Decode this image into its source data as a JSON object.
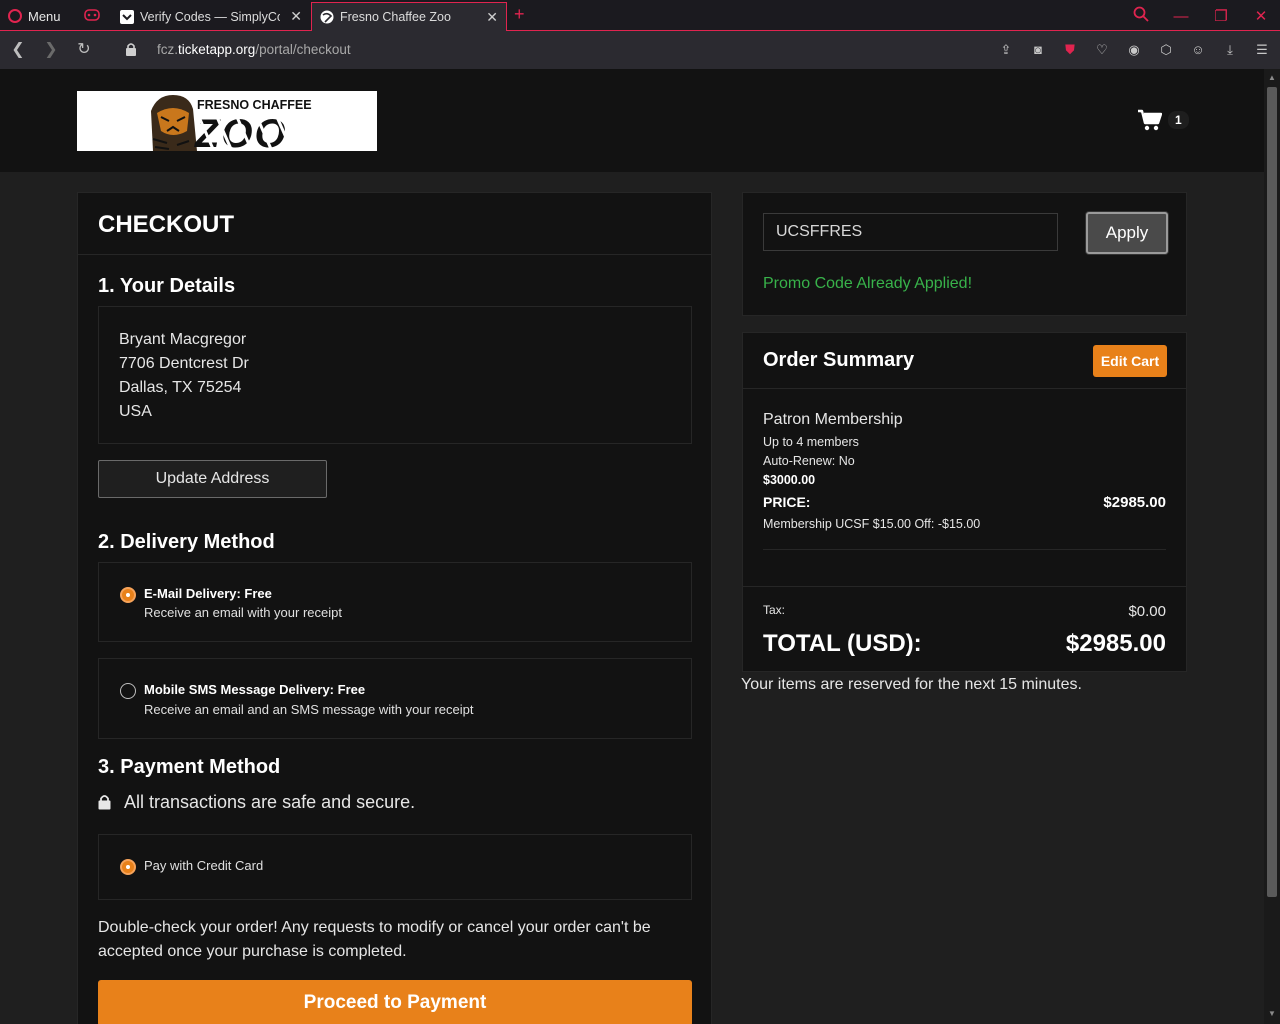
{
  "browser": {
    "menu_label": "Menu",
    "tabs": [
      {
        "label": "Verify Codes — SimplyCod"
      },
      {
        "label": "Fresno Chaffee Zoo"
      }
    ],
    "url_prefix": "fcz.",
    "url_domain": "ticketapp.org",
    "url_path": "/portal/checkout",
    "accent_color": "#e0244f"
  },
  "header": {
    "logo_text": "FRESNO CHAFFEE",
    "logo_big": "ZOO",
    "cart_count": "1"
  },
  "checkout": {
    "title": "CHECKOUT",
    "details_title": "1. Your Details",
    "address": [
      "Bryant Macgregor",
      "7706 Dentcrest Dr",
      "Dallas, TX 75254",
      "USA"
    ],
    "update_address_label": "Update Address",
    "delivery_title": "2. Delivery Method",
    "delivery_options": [
      {
        "title": "E-Mail Delivery: Free",
        "subtitle": "Receive an email with your receipt",
        "selected": true
      },
      {
        "title": "Mobile SMS Message Delivery: Free",
        "subtitle": "Receive an email and an SMS message with your receipt",
        "selected": false
      }
    ],
    "payment_title": "3. Payment Method",
    "secure_text": "All transactions are safe and secure.",
    "payment_option": "Pay with Credit Card",
    "note": "Double-check your order! Any requests to modify or cancel your order can't be accepted once your purchase is completed.",
    "proceed_label": "Proceed to Payment",
    "button_color": "#e8811a"
  },
  "promo": {
    "code_value": "UCSFFRES",
    "apply_label": "Apply",
    "message": "Promo Code Already Applied!",
    "message_color": "#38b24a"
  },
  "summary": {
    "title": "Order Summary",
    "edit_cart_label": "Edit Cart",
    "item_name": "Patron Membership",
    "item_members": "Up to 4 members",
    "item_autorenew": "Auto-Renew: No",
    "item_base_price": "$3000.00",
    "price_label": "PRICE:",
    "price_value": "$2985.00",
    "discount_text": "Membership UCSF $15.00 Off: -$15.00",
    "tax_label": "Tax:",
    "tax_value": "$0.00",
    "total_label": "TOTAL (USD):",
    "total_value": "$2985.00",
    "reserve_text": "Your items are reserved for the next 15 minutes."
  }
}
